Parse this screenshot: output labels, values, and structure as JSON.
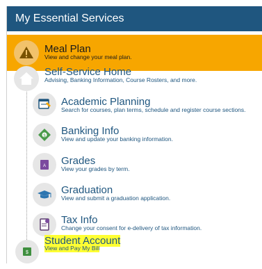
{
  "header": {
    "title": "My Essential Services"
  },
  "meal_plan": {
    "title": "Meal Plan",
    "desc": "View and change your meal plan.",
    "icon": "warning-icon"
  },
  "self_service": {
    "title": "Self-Service Home",
    "desc": "Advising, Banking Information, Course Rosters, and more.",
    "icon": "home-icon"
  },
  "items": [
    {
      "title": "Academic Planning",
      "desc": "Search for courses, plan terms, schedule and register course sections.",
      "icon": "planning-icon"
    },
    {
      "title": "Banking Info",
      "desc": "View and update your banking information.",
      "icon": "banking-icon"
    },
    {
      "title": "Grades",
      "desc": "View your grades by term.",
      "icon": "grades-icon"
    },
    {
      "title": "Graduation",
      "desc": "View and submit a graduation application.",
      "icon": "graduation-cap-icon"
    },
    {
      "title": "Tax Info",
      "desc": "Change your consent for e-delivery of tax information.",
      "icon": "tax-document-icon"
    }
  ],
  "student_account": {
    "title": "Student Account",
    "desc": "View and Pay My Bill",
    "icon": "money-icon"
  },
  "colors": {
    "header": "#1f567f",
    "alert": "#f7a600",
    "link": "#1f567f",
    "highlight": "#ffff33"
  }
}
